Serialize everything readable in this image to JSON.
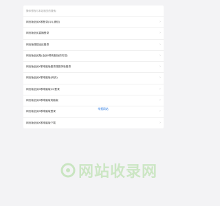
{
  "card": {
    "header": "猜你想找与本站相关的搜索:"
  },
  "items": [
    {
      "label": "网页版全民K歌登录(QQ,微信)"
    },
    {
      "label": "网页版全民直播登录"
    },
    {
      "label": "网页版搜狐全民登录"
    },
    {
      "label": "网页版全民瓶(全民K歌电脑版的内容)"
    },
    {
      "label": "网页版全民K歌电脑版登录搜狐体验登录"
    },
    {
      "label": "网页版全民K歌电脑版(网页)"
    },
    {
      "label": "网页版全民K歌电脑版QQ登录"
    },
    {
      "label": "网页版全民K歌电脑版电脑版"
    },
    {
      "label": "网页版全民K歌电脑版登录"
    },
    {
      "label": "网页版全民K歌电脑版下载"
    }
  ],
  "footer": {
    "report_link": "举报网站"
  },
  "watermark": {
    "text": "网站收录网"
  },
  "colors": {
    "link": "#2a7ae2",
    "watermark": "#c9e5c1"
  }
}
